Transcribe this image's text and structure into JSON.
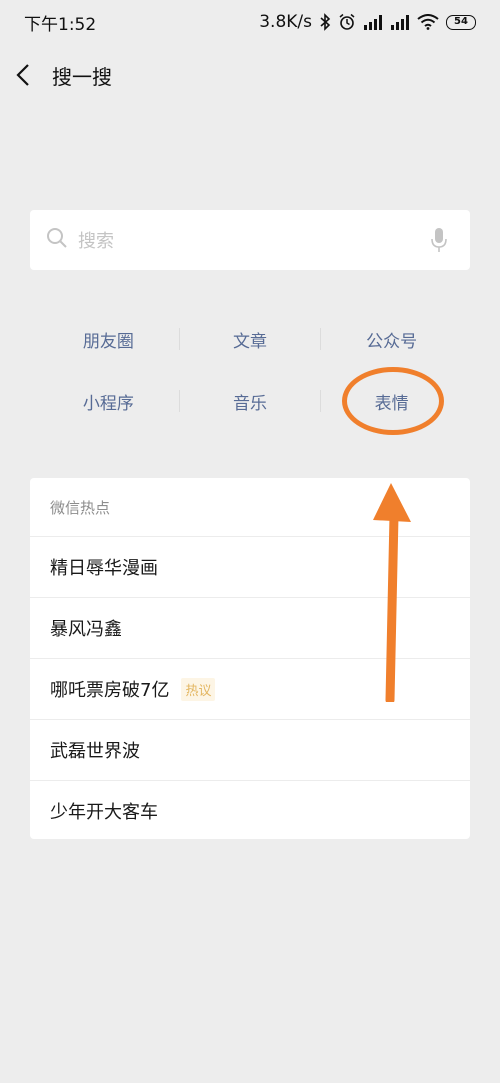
{
  "status_bar": {
    "time": "下午1:52",
    "network_speed": "3.8K/s",
    "battery": "54",
    "icons": [
      "bluetooth-icon",
      "alarm-icon",
      "signal-icon",
      "signal-icon",
      "wifi-icon",
      "battery-icon"
    ]
  },
  "nav": {
    "back_icon": "chevron-left-icon",
    "title": "搜一搜"
  },
  "search": {
    "placeholder": "搜索",
    "icon": "search-icon",
    "voice_icon": "mic-icon"
  },
  "categories": [
    [
      "朋友圈",
      "文章",
      "公众号"
    ],
    [
      "小程序",
      "音乐",
      "表情"
    ]
  ],
  "hot": {
    "header": "微信热点",
    "items": [
      {
        "label": "精日辱华漫画",
        "badge": ""
      },
      {
        "label": "暴风冯鑫",
        "badge": ""
      },
      {
        "label": "哪吒票房破7亿",
        "badge": "热议"
      },
      {
        "label": "武磊世界波",
        "badge": ""
      },
      {
        "label": "少年开大客车",
        "badge": ""
      }
    ]
  },
  "annotation": {
    "color": "#f07f2c",
    "highlighted_item": "表情"
  }
}
